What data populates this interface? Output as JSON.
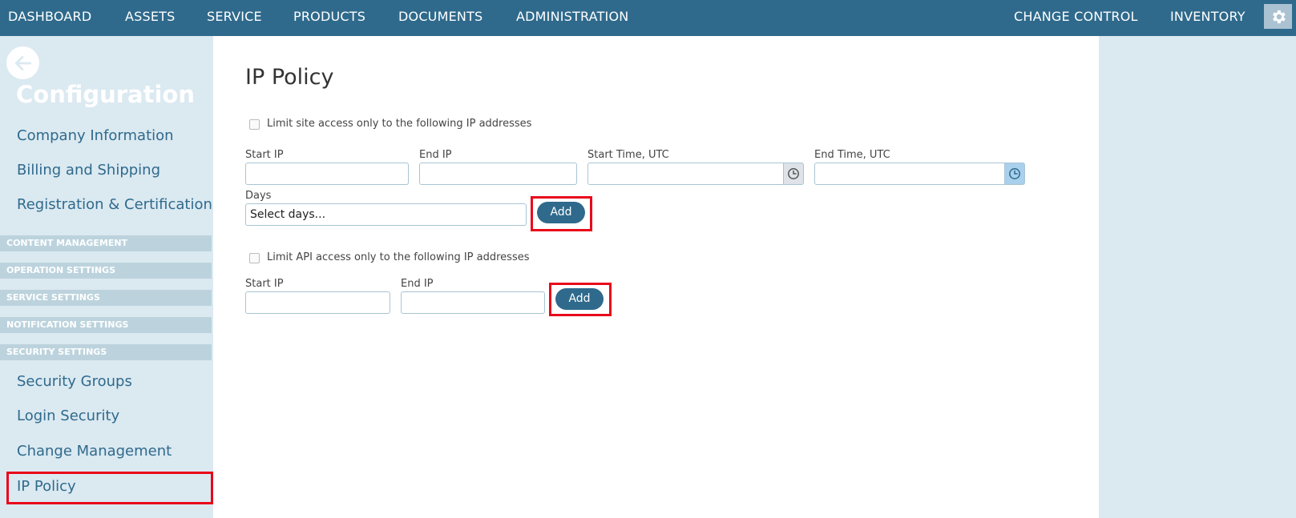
{
  "nav": {
    "items": [
      "DASHBOARD",
      "ASSETS",
      "SERVICE",
      "PRODUCTS",
      "DOCUMENTS",
      "ADMINISTRATION",
      "CHANGE CONTROL",
      "INVENTORY"
    ]
  },
  "sidebar": {
    "title": "Configuration",
    "links_top": [
      "Company Information",
      "Billing and Shipping",
      "Registration & Certification"
    ],
    "sections": [
      "CONTENT MANAGEMENT",
      "OPERATION SETTINGS",
      "SERVICE SETTINGS",
      "NOTIFICATION SETTINGS",
      "SECURITY SETTINGS"
    ],
    "links_security": [
      "Security Groups",
      "Login Security",
      "Change Management",
      "IP Policy"
    ]
  },
  "main": {
    "title": "IP Policy",
    "site": {
      "checkbox_label": "Limit site access only to the following IP addresses",
      "start_ip_label": "Start IP",
      "end_ip_label": "End IP",
      "start_time_label": "Start Time, UTC",
      "end_time_label": "End Time, UTC",
      "days_label": "Days",
      "days_placeholder": "Select days...",
      "add_label": "Add"
    },
    "api": {
      "checkbox_label": "Limit API access only to the following IP addresses",
      "start_ip_label": "Start IP",
      "end_ip_label": "End IP",
      "add_label": "Add"
    }
  },
  "colors": {
    "nav_bg": "#2f6a8c",
    "sidebar_bg": "#dbe9f1",
    "highlight": "#e8081a"
  }
}
